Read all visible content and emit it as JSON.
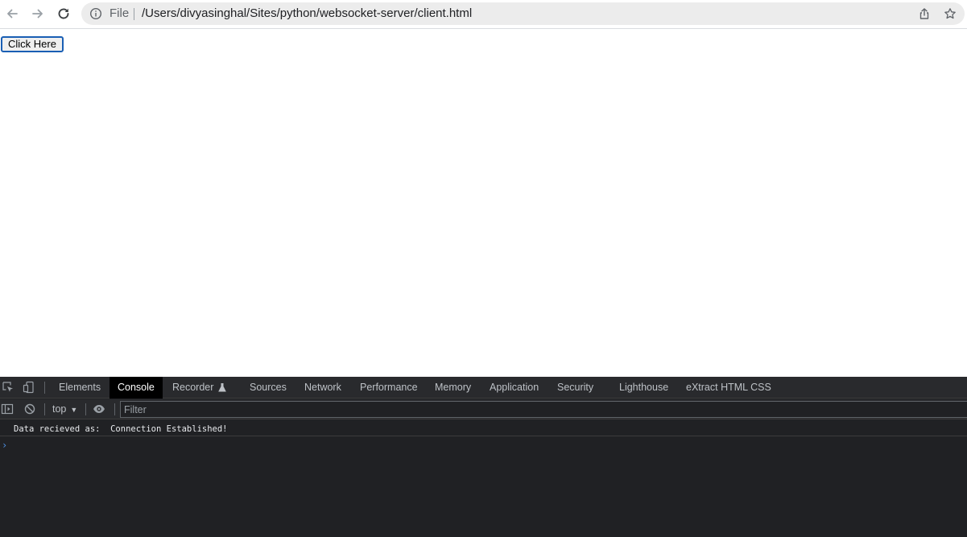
{
  "browser": {
    "omnibox": {
      "scheme_label": "File",
      "url": "/Users/divyasinghal/Sites/python/websocket-server/client.html"
    },
    "icons": {
      "back": "arrow-left-icon",
      "forward": "arrow-right-icon",
      "reload": "reload-icon",
      "info": "info-circle-icon",
      "share": "share-icon",
      "bookmark": "star-icon"
    }
  },
  "page": {
    "button_label": "Click Here"
  },
  "devtools": {
    "tabs": [
      {
        "label": "Elements",
        "active": false
      },
      {
        "label": "Console",
        "active": true
      },
      {
        "label": "Recorder",
        "active": false
      },
      {
        "label": "Sources",
        "active": false
      },
      {
        "label": "Network",
        "active": false
      },
      {
        "label": "Performance",
        "active": false
      },
      {
        "label": "Memory",
        "active": false
      },
      {
        "label": "Application",
        "active": false
      },
      {
        "label": "Security",
        "active": false
      },
      {
        "label": "Lighthouse",
        "active": false
      },
      {
        "label": "eXtract HTML CSS",
        "active": false
      }
    ],
    "context": "top",
    "filter_placeholder": "Filter",
    "console": {
      "messages": [
        "Data recieved as:  Connection Established!"
      ],
      "prompt": "›"
    },
    "colors": {
      "background": "#202124",
      "active_tab": "#000000",
      "prompt": "#4d8fe0"
    }
  }
}
